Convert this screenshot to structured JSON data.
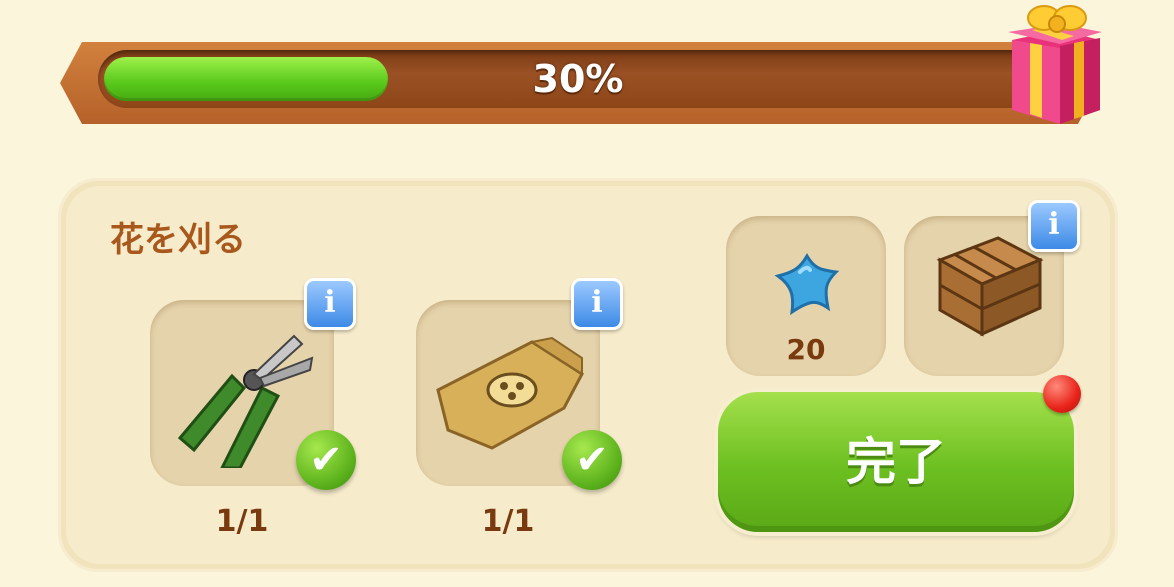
{
  "progress": {
    "value": 0.3,
    "label": "30%"
  },
  "task": {
    "title": "花を刈る",
    "requirements": [
      {
        "item": "pruning-shears",
        "count": "1/1",
        "completed": true
      },
      {
        "item": "seed-bag",
        "count": "1/1",
        "completed": true
      }
    ]
  },
  "rewards": {
    "star_amount": "20",
    "crate": "wooden-crate"
  },
  "info_badge_label": "i",
  "check_glyph": "✔",
  "complete_button": {
    "label": "完了",
    "has_notification": true
  },
  "colors": {
    "accent_green": "#6cbf20",
    "bar_brown": "#9a5124",
    "title_brown": "#a8581c",
    "info_blue": "#3d8ae6",
    "notification_red": "#e8231a"
  }
}
